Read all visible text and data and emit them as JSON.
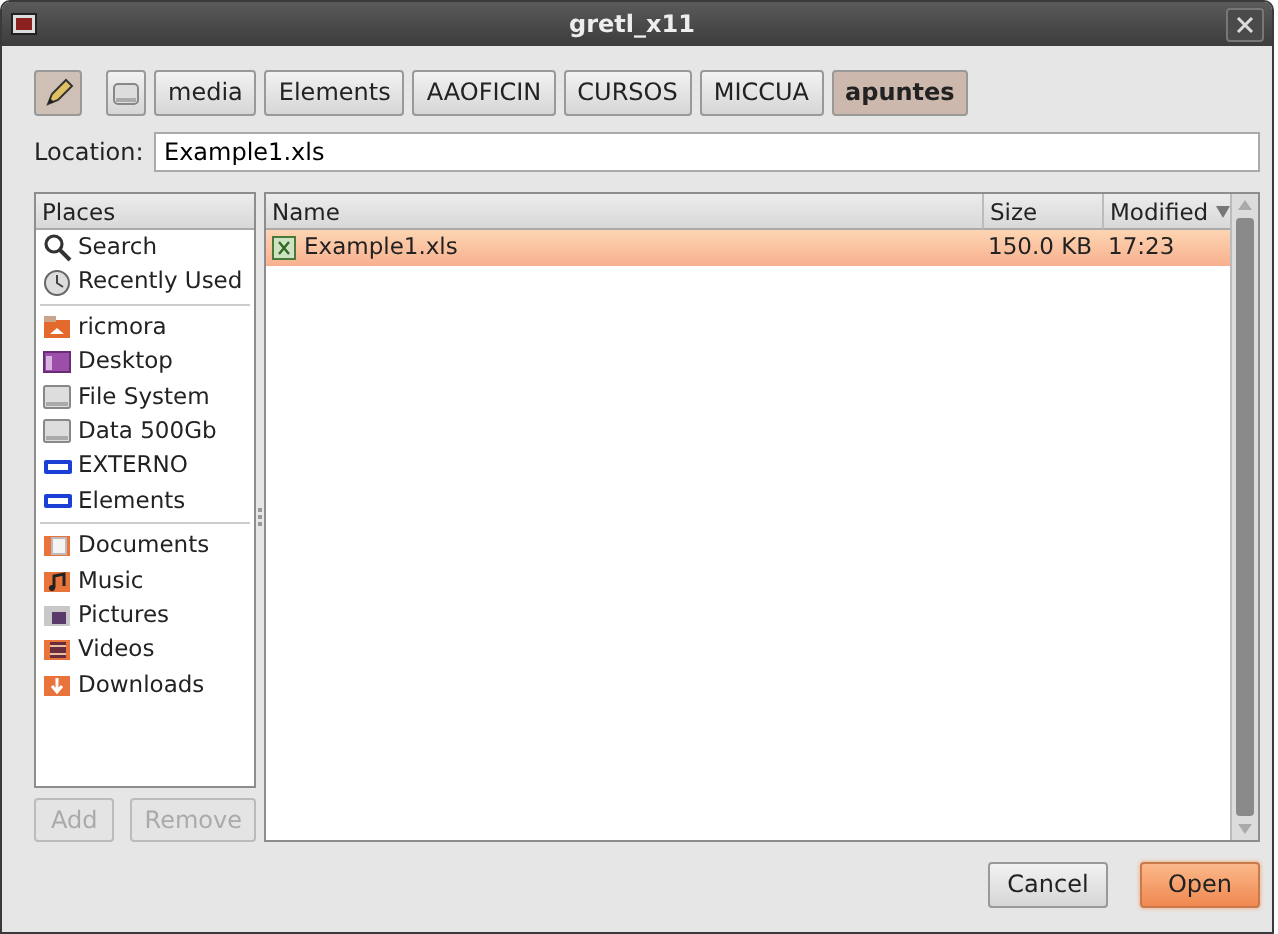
{
  "window": {
    "title": "gretl_x11"
  },
  "path_bar": {
    "edit_toggle": {
      "pressed": true
    },
    "crumbs": [
      {
        "kind": "drive",
        "selected": false
      },
      {
        "label": "media",
        "kind": "folder",
        "selected": false
      },
      {
        "label": "Elements",
        "kind": "folder",
        "selected": false
      },
      {
        "label": "AAOFICIN",
        "kind": "folder",
        "selected": false
      },
      {
        "label": "CURSOS",
        "kind": "folder",
        "selected": false
      },
      {
        "label": "MICCUA",
        "kind": "folder",
        "selected": false
      },
      {
        "label": "apuntes",
        "kind": "folder",
        "selected": true
      }
    ]
  },
  "location": {
    "label": "Location:",
    "value": "Example1.xls"
  },
  "places": {
    "header": "Places",
    "groups": [
      [
        {
          "label": "Search",
          "kind": "search"
        },
        {
          "label": "Recently Used",
          "kind": "recent"
        }
      ],
      [
        {
          "label": "ricmora",
          "kind": "home"
        },
        {
          "label": "Desktop",
          "kind": "desktop"
        },
        {
          "label": "File System",
          "kind": "drive"
        },
        {
          "label": "Data 500Gb",
          "kind": "drive"
        },
        {
          "label": "EXTERNO",
          "kind": "wd"
        },
        {
          "label": "Elements",
          "kind": "wd"
        }
      ],
      [
        {
          "label": "Documents",
          "kind": "documents"
        },
        {
          "label": "Music",
          "kind": "music"
        },
        {
          "label": "Pictures",
          "kind": "pictures"
        },
        {
          "label": "Videos",
          "kind": "videos"
        },
        {
          "label": "Downloads",
          "kind": "downloads"
        }
      ]
    ],
    "buttons": [
      {
        "label": "Add",
        "disabled": true
      },
      {
        "label": "Remove",
        "disabled": true
      }
    ]
  },
  "files": {
    "columns": [
      {
        "label": "Name",
        "sorted": false
      },
      {
        "label": "Size",
        "sorted": false
      },
      {
        "label": "Modified",
        "sorted": true
      }
    ],
    "rows": [
      {
        "name": "Example1.xls",
        "size": "150.0 KB",
        "modified": "17:23",
        "selected": true
      }
    ]
  },
  "buttons": [
    {
      "label": "Cancel",
      "default": false
    },
    {
      "label": "Open",
      "default": true
    }
  ]
}
